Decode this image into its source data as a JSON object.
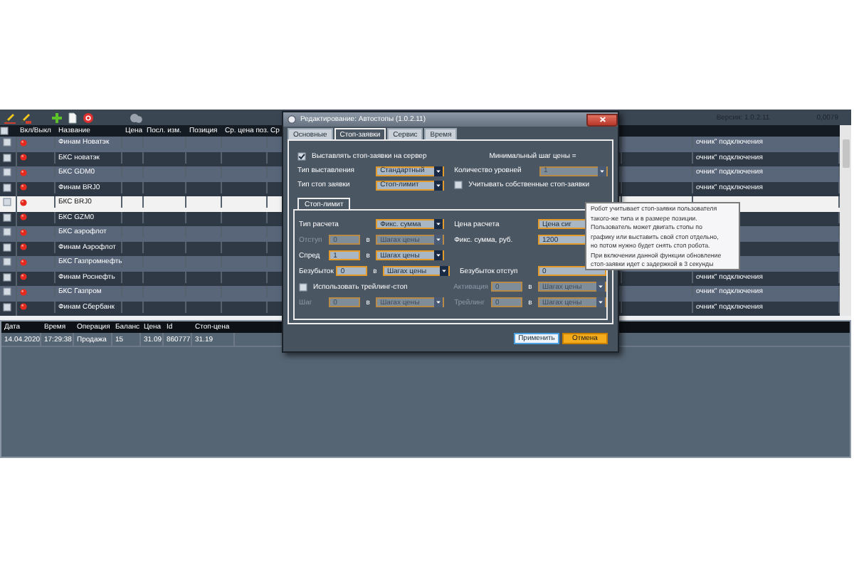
{
  "toolbar": {
    "version": "Версия: 1.0.2.11",
    "value": "0,0079"
  },
  "instruments": {
    "all_checked": false,
    "columns": [
      "Вкл/Выкл",
      "Название",
      "Цена",
      "Посл. изм.",
      "Позиция",
      "Ср. цена поз.",
      "Ср"
    ],
    "rows": [
      {
        "checked": false,
        "name": "Финам Новатэк",
        "selected": false,
        "column_9": "очник\" подключения"
      },
      {
        "checked": false,
        "name": "БКС новатэк",
        "selected": false,
        "column_9": "очник\" подключения"
      },
      {
        "checked": false,
        "name": "БКС GDM0",
        "selected": false,
        "column_9": "очник\" подключения"
      },
      {
        "checked": false,
        "name": "Финам BRJ0",
        "selected": false,
        "column_9": "очник\" подключения"
      },
      {
        "checked": false,
        "name": "БКС BRJ0",
        "selected": true
      },
      {
        "checked": false,
        "name": "БКС GZM0",
        "selected": false
      },
      {
        "checked": false,
        "name": "БКС аэрофлот",
        "selected": false
      },
      {
        "checked": false,
        "name": "Финам Аэрофлот",
        "selected": false
      },
      {
        "checked": false,
        "name": "БКС Газпромнефть",
        "selected": false
      },
      {
        "checked": false,
        "name": "Финам Роснефть",
        "selected": false,
        "column_9": "очник\" подключения"
      },
      {
        "checked": false,
        "name": "БКС Газпром",
        "selected": false,
        "column_9": "очник\" подключения"
      },
      {
        "checked": false,
        "name": "Финам Сбербанк",
        "selected": false,
        "column_9": "очник\" подключения"
      }
    ]
  },
  "orders": {
    "columns": [
      "Дата",
      "Время",
      "Операция",
      "Баланс",
      "Цена",
      "Id",
      "Стоп-цена"
    ],
    "rows": [
      [
        "14.04.2020",
        "17:29:38",
        "Продажа",
        "15",
        "31.09",
        "860777",
        "31.19"
      ]
    ]
  },
  "dialog": {
    "title": "Редактирование: Автостопы (1.0.2.11)",
    "tabs": [
      {
        "label": "Основные",
        "selected": false
      },
      {
        "label": "Стоп-заявки",
        "selected": true
      },
      {
        "label": "Сервис",
        "selected": false
      },
      {
        "label": "Время",
        "selected": false
      }
    ],
    "settings": [
      {
        "left": [
          {
            "kind": "checkbox",
            "label": "Выставлять стоп-заявки на сервер",
            "checked": true
          }
        ],
        "right": [
          {
            "kind": "label",
            "text": "Минимальный шаг цены =",
            "disabled": false
          }
        ]
      },
      {
        "left": [
          {
            "kind": "label",
            "text": "Тип выставления",
            "disabled": false
          },
          {
            "kind": "select",
            "value": "Стандартный",
            "disabled": false
          }
        ],
        "right": [
          {
            "kind": "label",
            "text": "Количество уровней",
            "disabled": false
          },
          {
            "kind": "select",
            "value": "1",
            "disabled": true
          }
        ]
      },
      {
        "left": [
          {
            "kind": "label",
            "text": "Тип стоп заявки",
            "disabled": false
          },
          {
            "kind": "select",
            "value": "Стоп-лимит",
            "disabled": false
          }
        ],
        "right": [
          {
            "kind": "checkbox",
            "label": "Учитывать собственные стоп-заявки",
            "checked": false
          }
        ]
      }
    ],
    "sub_tabs": [
      {
        "label": "Стоп-лимит",
        "selected": true
      }
    ],
    "stop_limit": [
      {
        "left": [
          {
            "kind": "label",
            "text": "Тип расчета",
            "disabled": false
          },
          {
            "kind": "select",
            "value": "Фикс. сумма",
            "disabled": false
          }
        ],
        "right": [
          {
            "kind": "label",
            "text": "Цена расчета",
            "disabled": false
          },
          {
            "kind": "input",
            "value": "Цена сиг",
            "disabled": false
          }
        ]
      },
      {
        "left": [
          {
            "kind": "label",
            "text": "Отступ",
            "disabled": true
          },
          {
            "kind": "input",
            "value": "0",
            "disabled": true
          },
          {
            "kind": "unit",
            "text": "в"
          },
          {
            "kind": "select",
            "value": "Шагах цены",
            "disabled": true
          }
        ],
        "right": [
          {
            "kind": "label",
            "text": "Фикс. сумма, руб.",
            "disabled": false
          },
          {
            "kind": "input",
            "value": "1200",
            "disabled": false
          }
        ]
      },
      {
        "left": [
          {
            "kind": "label",
            "text": "Спред",
            "disabled": false
          },
          {
            "kind": "input",
            "value": "1",
            "disabled": false
          },
          {
            "kind": "unit",
            "text": "в"
          },
          {
            "kind": "select",
            "value": "Шагах цены",
            "disabled": false
          }
        ]
      },
      {
        "left": [
          {
            "kind": "label",
            "text": "Безубыток",
            "disabled": false
          },
          {
            "kind": "input",
            "value": "0",
            "disabled": false
          },
          {
            "kind": "unit",
            "text": "в"
          },
          {
            "kind": "select",
            "value": "Шагах цены",
            "disabled": false
          }
        ],
        "right": [
          {
            "kind": "label",
            "text": "Безубыток отступ",
            "disabled": false
          },
          {
            "kind": "input",
            "value": "0",
            "disabled": false
          }
        ]
      },
      {
        "left": [
          {
            "kind": "checkbox",
            "label": "Использовать трейлинг-стоп",
            "checked": false
          }
        ],
        "right": [
          {
            "kind": "label",
            "text": "Активация",
            "disabled": true
          },
          {
            "kind": "input",
            "value": "0",
            "disabled": true
          },
          {
            "kind": "unit",
            "text": "в"
          },
          {
            "kind": "select",
            "value": "Шагах цены",
            "disabled": true
          }
        ]
      },
      {
        "left": [
          {
            "kind": "label",
            "text": "Шаг",
            "disabled": true
          },
          {
            "kind": "input",
            "value": "0",
            "disabled": true
          },
          {
            "kind": "unit",
            "text": "в"
          },
          {
            "kind": "select",
            "value": "Шагах цены",
            "disabled": true
          }
        ],
        "right": [
          {
            "kind": "label",
            "text": "Трейлинг",
            "disabled": true
          },
          {
            "kind": "input",
            "value": "0",
            "disabled": true
          },
          {
            "kind": "unit",
            "text": "в"
          },
          {
            "kind": "select",
            "value": "Шагах цены",
            "disabled": true
          }
        ]
      }
    ],
    "buttons": [
      {
        "label": "Применить",
        "kind": "apply"
      },
      {
        "label": "Отмена",
        "kind": "cancel"
      }
    ]
  },
  "tooltip": {
    "text": "Робот учитывает стоп-заявки пользователя\nтакого-же типа и в размере позиции.\nПользователь может двигать стопы по\nграфику или выставить свой стоп отдельно,\nно потом нужно будет снять стоп робота.\nПри включении данной функции обновление\nстоп-заявки идет с задержкой в 3 секунды"
  }
}
